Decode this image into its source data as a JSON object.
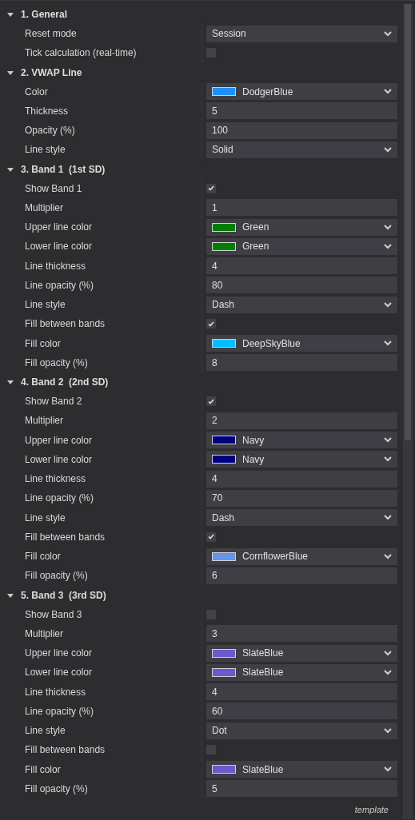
{
  "sections": [
    {
      "title": "1. General",
      "expanded": true,
      "rows": [
        {
          "label": "Reset mode",
          "kind": "select",
          "value": "Session"
        },
        {
          "label": "Tick calculation (real-time)",
          "kind": "check",
          "checked": false
        }
      ]
    },
    {
      "title": "2. VWAP Line",
      "expanded": true,
      "rows": [
        {
          "label": "Color",
          "kind": "color",
          "value": "DodgerBlue",
          "color": "#1e90ff"
        },
        {
          "label": "Thickness",
          "kind": "text",
          "value": "5"
        },
        {
          "label": "Opacity (%)",
          "kind": "text",
          "value": "100"
        },
        {
          "label": "Line style",
          "kind": "select",
          "value": "Solid"
        }
      ]
    },
    {
      "title": "3. Band 1  (1st SD)",
      "expanded": true,
      "rows": [
        {
          "label": "Show Band 1",
          "kind": "check",
          "checked": true
        },
        {
          "label": "Multiplier",
          "kind": "text",
          "value": "1"
        },
        {
          "label": "Upper line color",
          "kind": "color",
          "value": "Green",
          "color": "#008000"
        },
        {
          "label": "Lower line color",
          "kind": "color",
          "value": "Green",
          "color": "#008000"
        },
        {
          "label": "Line thickness",
          "kind": "text",
          "value": "4"
        },
        {
          "label": "Line opacity (%)",
          "kind": "text",
          "value": "80"
        },
        {
          "label": "Line style",
          "kind": "select",
          "value": "Dash"
        },
        {
          "label": "Fill between bands",
          "kind": "check",
          "checked": true
        },
        {
          "label": "Fill color",
          "kind": "color",
          "value": "DeepSkyBlue",
          "color": "#00bfff"
        },
        {
          "label": "Fill opacity (%)",
          "kind": "text",
          "value": "8"
        }
      ]
    },
    {
      "title": "4. Band 2  (2nd SD)",
      "expanded": true,
      "rows": [
        {
          "label": "Show Band 2",
          "kind": "check",
          "checked": true
        },
        {
          "label": "Multiplier",
          "kind": "text",
          "value": "2"
        },
        {
          "label": "Upper line color",
          "kind": "color",
          "value": "Navy",
          "color": "#000080"
        },
        {
          "label": "Lower line color",
          "kind": "color",
          "value": "Navy",
          "color": "#000080"
        },
        {
          "label": "Line thickness",
          "kind": "text",
          "value": "4"
        },
        {
          "label": "Line opacity (%)",
          "kind": "text",
          "value": "70"
        },
        {
          "label": "Line style",
          "kind": "select",
          "value": "Dash"
        },
        {
          "label": "Fill between bands",
          "kind": "check",
          "checked": true
        },
        {
          "label": "Fill color",
          "kind": "color",
          "value": "CornflowerBlue",
          "color": "#6495ed"
        },
        {
          "label": "Fill opacity (%)",
          "kind": "text",
          "value": "6"
        }
      ]
    },
    {
      "title": "5. Band 3  (3rd SD)",
      "expanded": true,
      "rows": [
        {
          "label": "Show Band 3",
          "kind": "check",
          "checked": false
        },
        {
          "label": "Multiplier",
          "kind": "text",
          "value": "3"
        },
        {
          "label": "Upper line color",
          "kind": "color",
          "value": "SlateBlue",
          "color": "#6a5acd"
        },
        {
          "label": "Lower line color",
          "kind": "color",
          "value": "SlateBlue",
          "color": "#6a5acd"
        },
        {
          "label": "Line thickness",
          "kind": "text",
          "value": "4"
        },
        {
          "label": "Line opacity (%)",
          "kind": "text",
          "value": "60"
        },
        {
          "label": "Line style",
          "kind": "select",
          "value": "Dot"
        },
        {
          "label": "Fill between bands",
          "kind": "check",
          "checked": false
        },
        {
          "label": "Fill color",
          "kind": "color",
          "value": "SlateBlue",
          "color": "#6a5acd"
        },
        {
          "label": "Fill opacity (%)",
          "kind": "text",
          "value": "5"
        }
      ]
    }
  ],
  "footer": "template"
}
